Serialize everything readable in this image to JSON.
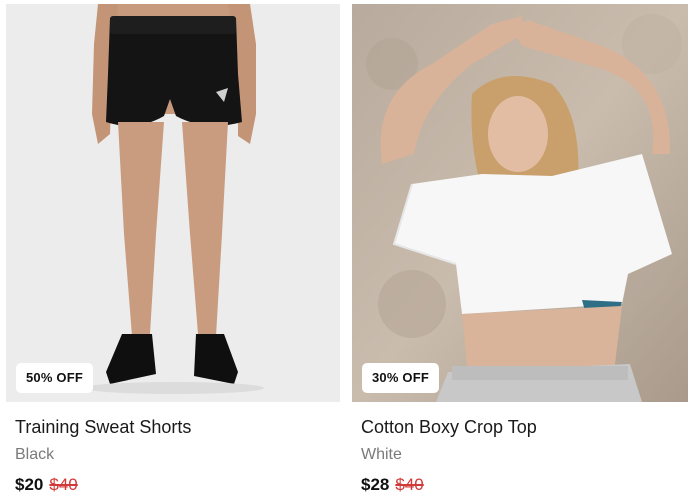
{
  "products": [
    {
      "badge": "50% OFF",
      "title": "Training Sweat Shorts",
      "color": "Black",
      "price": "$20",
      "old_price": "$40"
    },
    {
      "badge": "30% OFF",
      "title": "Cotton Boxy Crop Top",
      "color": "White",
      "price": "$28",
      "old_price": "$40"
    }
  ],
  "colors": {
    "sale_price": "#d23a3a",
    "muted_text": "#7a7a7a",
    "badge_bg": "#ffffff"
  }
}
